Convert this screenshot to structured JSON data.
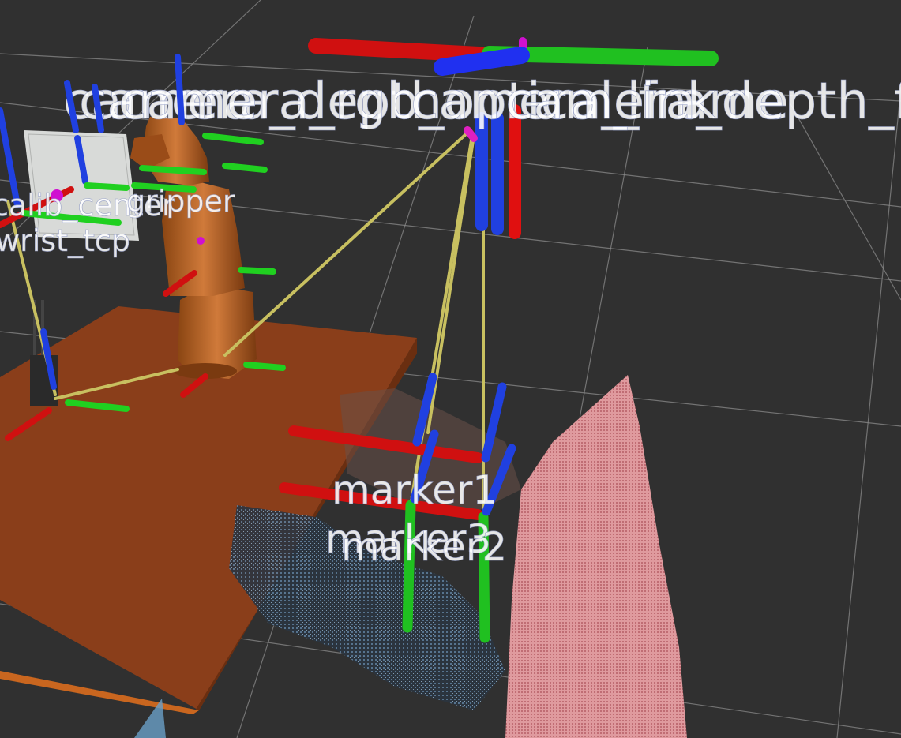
{
  "viewport": {
    "background": "#303030",
    "grid_color": "#a0a0a0",
    "axis_colors": {
      "x": "#e01010",
      "y": "#10d010",
      "z": "#1020e0"
    },
    "link_color": "#c8c060"
  },
  "frame_labels": {
    "camera_stack": [
      "camera",
      "camera_depth",
      "camera_rgb_optical_frame",
      "camera_link",
      "camera_depth_frame"
    ],
    "left_overlap": "wrist_tcp",
    "left_overlap_2": "calib_center",
    "gripper": "gripper",
    "marker1": "marker1",
    "marker2": "marker2",
    "marker_overlap": "marker3"
  },
  "objects": {
    "robot_arm": "industrial-robot",
    "table": "work-table",
    "calibration_board": "calibration-board",
    "point_cloud": "depth-point-cloud"
  }
}
